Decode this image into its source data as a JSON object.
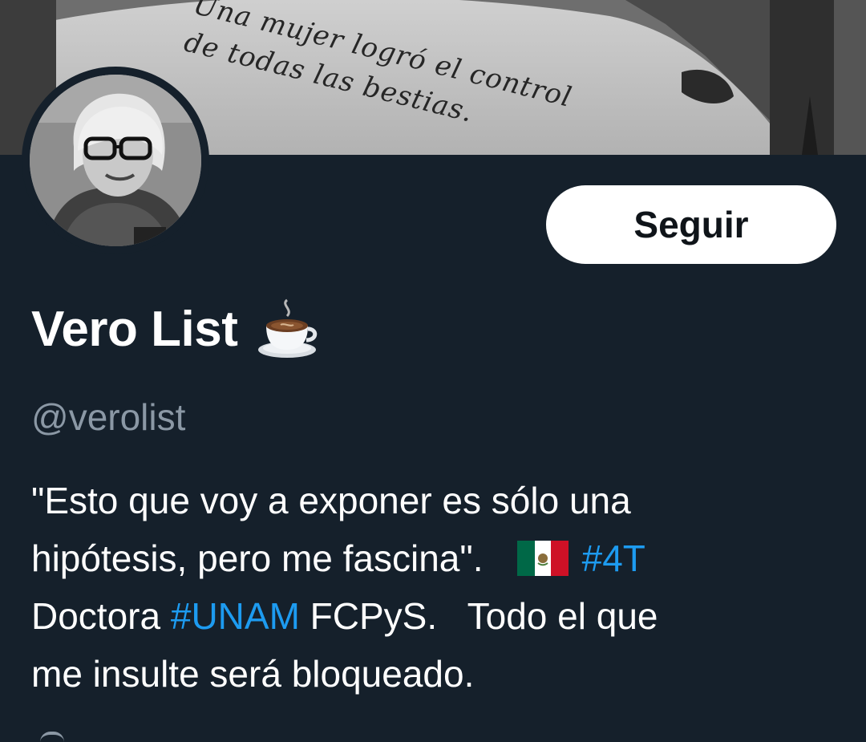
{
  "banner": {
    "tattoo_text": "Una mujer logró el control\nde todas las bestias."
  },
  "profile": {
    "display_name": "Vero List",
    "name_icon": "coffee-icon",
    "handle": "@verolist"
  },
  "actions": {
    "follow_label": "Seguir"
  },
  "bio": {
    "line1": "\"Esto que voy a exponer es sólo una",
    "line2_text": "hipótesis, pero me fascina\".   ",
    "flag_icon": "mexico-flag-icon",
    "hashtag_4t": "#4T",
    "line3_pre": "Doctora ",
    "hashtag_unam": "#UNAM",
    "line3_post": " FCPyS.   Todo el que",
    "line4": "me insulte será bloqueado."
  },
  "colors": {
    "background": "#15202b",
    "accent": "#1d9bf0",
    "secondary_text": "#8b98a5",
    "button_bg": "#ffffff"
  }
}
